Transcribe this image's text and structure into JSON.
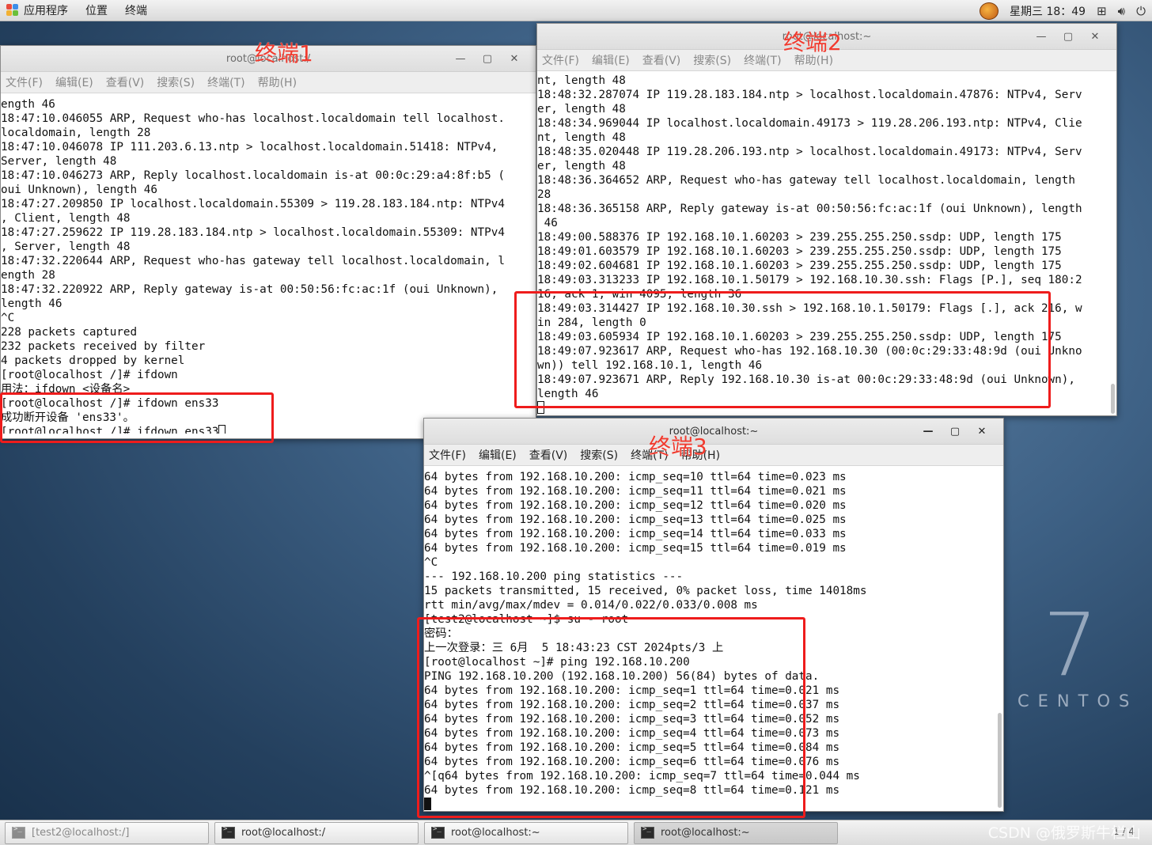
{
  "top_panel": {
    "applications": "应用程序",
    "places": "位置",
    "terminal": "终端",
    "clock": "星期三 18：49",
    "icons": [
      "system-tray-icon",
      "network-icon",
      "volume-icon",
      "power-icon"
    ]
  },
  "windows": {
    "w1": {
      "title": "root@localhost:/",
      "annotation": "终端1",
      "menu": [
        "文件(F)",
        "编辑(E)",
        "查看(V)",
        "搜索(S)",
        "终端(T)",
        "帮助(H)"
      ],
      "lines": [
        "ength 46",
        "18:47:10.046055 ARP, Request who-has localhost.localdomain tell localhost.",
        "localdomain, length 28",
        "18:47:10.046078 IP 111.203.6.13.ntp > localhost.localdomain.51418: NTPv4,",
        "Server, length 48",
        "18:47:10.046273 ARP, Reply localhost.localdomain is-at 00:0c:29:a4:8f:b5 (",
        "oui Unknown), length 46",
        "18:47:27.209850 IP localhost.localdomain.55309 > 119.28.183.184.ntp: NTPv4",
        ", Client, length 48",
        "18:47:27.259622 IP 119.28.183.184.ntp > localhost.localdomain.55309: NTPv4",
        ", Server, length 48",
        "18:47:32.220644 ARP, Request who-has gateway tell localhost.localdomain, l",
        "ength 28",
        "18:47:32.220922 ARP, Reply gateway is-at 00:50:56:fc:ac:1f (oui Unknown),",
        "length 46",
        "^C",
        "228 packets captured",
        "232 packets received by filter",
        "4 packets dropped by kernel",
        "[root@localhost /]# ifdown",
        "用法：ifdown <设备名>",
        "[root@localhost /]# ifdown ens33",
        "成功断开设备 'ens33'。",
        "[root@localhost /]# ifdown ens33"
      ]
    },
    "w2": {
      "title": "root@localhost:~",
      "annotation": "终端2",
      "menu": [
        "文件(F)",
        "编辑(E)",
        "查看(V)",
        "搜索(S)",
        "终端(T)",
        "帮助(H)"
      ],
      "lines": [
        "nt, length 48",
        "18:48:32.287074 IP 119.28.183.184.ntp > localhost.localdomain.47876: NTPv4, Serv",
        "er, length 48",
        "18:48:34.969044 IP localhost.localdomain.49173 > 119.28.206.193.ntp: NTPv4, Clie",
        "nt, length 48",
        "18:48:35.020448 IP 119.28.206.193.ntp > localhost.localdomain.49173: NTPv4, Serv",
        "er, length 48",
        "18:48:36.364652 ARP, Request who-has gateway tell localhost.localdomain, length",
        "28",
        "18:48:36.365158 ARP, Reply gateway is-at 00:50:56:fc:ac:1f (oui Unknown), length",
        " 46",
        "18:49:00.588376 IP 192.168.10.1.60203 > 239.255.255.250.ssdp: UDP, length 175",
        "18:49:01.603579 IP 192.168.10.1.60203 > 239.255.255.250.ssdp: UDP, length 175",
        "18:49:02.604681 IP 192.168.10.1.60203 > 239.255.255.250.ssdp: UDP, length 175",
        "18:49:03.313233 IP 192.168.10.1.50179 > 192.168.10.30.ssh: Flags [P.], seq 180:2",
        "16, ack 1, win 4095, length 36",
        "18:49:03.314427 IP 192.168.10.30.ssh > 192.168.10.1.50179: Flags [.], ack 216, w",
        "in 284, length 0",
        "18:49:03.605934 IP 192.168.10.1.60203 > 239.255.255.250.ssdp: UDP, length 175",
        "18:49:07.923617 ARP, Request who-has 192.168.10.30 (00:0c:29:33:48:9d (oui Unkno",
        "wn)) tell 192.168.10.1, length 46",
        "18:49:07.923671 ARP, Reply 192.168.10.30 is-at 00:0c:29:33:48:9d (oui Unknown),",
        "length 46"
      ]
    },
    "w3": {
      "title": "root@localhost:~",
      "annotation": "终端3",
      "menu": [
        "文件(F)",
        "编辑(E)",
        "查看(V)",
        "搜索(S)",
        "终端(T)",
        "帮助(H)"
      ],
      "lines": [
        "64 bytes from 192.168.10.200: icmp_seq=10 ttl=64 time=0.023 ms",
        "64 bytes from 192.168.10.200: icmp_seq=11 ttl=64 time=0.021 ms",
        "64 bytes from 192.168.10.200: icmp_seq=12 ttl=64 time=0.020 ms",
        "64 bytes from 192.168.10.200: icmp_seq=13 ttl=64 time=0.025 ms",
        "64 bytes from 192.168.10.200: icmp_seq=14 ttl=64 time=0.033 ms",
        "64 bytes from 192.168.10.200: icmp_seq=15 ttl=64 time=0.019 ms",
        "^C",
        "--- 192.168.10.200 ping statistics ---",
        "15 packets transmitted, 15 received, 0% packet loss, time 14018ms",
        "rtt min/avg/max/mdev = 0.014/0.022/0.033/0.008 ms",
        "[test2@localhost ~]$ su - root",
        "密码：",
        "上一次登录：三 6月  5 18:43:23 CST 2024pts/3 上",
        "[root@localhost ~]# ping 192.168.10.200",
        "PING 192.168.10.200 (192.168.10.200) 56(84) bytes of data.",
        "64 bytes from 192.168.10.200: icmp_seq=1 ttl=64 time=0.021 ms",
        "64 bytes from 192.168.10.200: icmp_seq=2 ttl=64 time=0.037 ms",
        "64 bytes from 192.168.10.200: icmp_seq=3 ttl=64 time=0.052 ms",
        "64 bytes from 192.168.10.200: icmp_seq=4 ttl=64 time=0.073 ms",
        "64 bytes from 192.168.10.200: icmp_seq=5 ttl=64 time=0.084 ms",
        "64 bytes from 192.168.10.200: icmp_seq=6 ttl=64 time=0.076 ms",
        "^[q64 bytes from 192.168.10.200: icmp_seq=7 ttl=64 time=0.044 ms",
        "64 bytes from 192.168.10.200: icmp_seq=8 ttl=64 time=0.121 ms",
        ""
      ]
    }
  },
  "desktop": {
    "logo_number": "7",
    "logo_word": "CENTOS"
  },
  "taskbar": {
    "tasks": [
      "[test2@localhost:/]",
      "root@localhost:/",
      "root@localhost:~",
      "root@localhost:~"
    ],
    "workspace": "1 / 4",
    "watermark": "CSDN @俄罗斯牛栏山"
  },
  "colors": {
    "annotation": "#f03a2e",
    "highlight_box": "#ee1c1c"
  }
}
